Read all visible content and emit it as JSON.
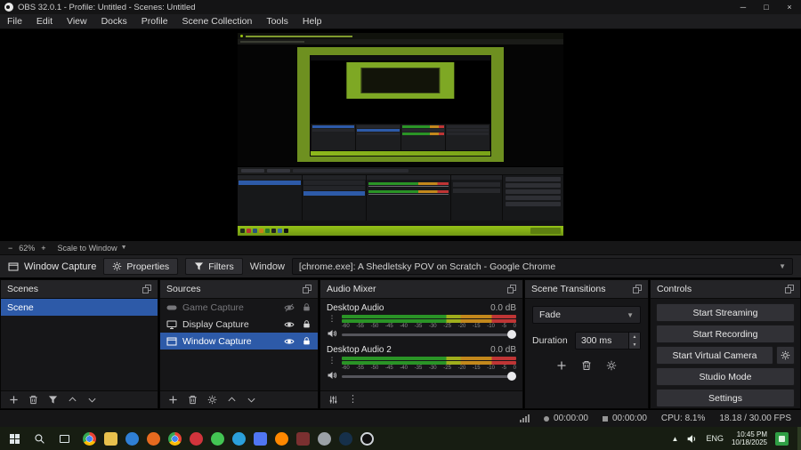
{
  "colors": {
    "accent": "#2d5aa8",
    "meter_green": "#2a9426",
    "meter_orange": "#c3881c",
    "meter_red": "#bf3535",
    "taskbar_green": "#8fbf17"
  },
  "titlebar": {
    "title": "OBS 32.0.1 - Profile: Untitled - Scenes: Untitled",
    "window_buttons": {
      "minimize": "─",
      "maximize": "□",
      "close": "×"
    }
  },
  "menubar": {
    "items": [
      "File",
      "Edit",
      "View",
      "Docks",
      "Profile",
      "Scene Collection",
      "Tools",
      "Help"
    ]
  },
  "preview_toolbar": {
    "zoom_out": "−",
    "zoom_level": "62%",
    "zoom_in": "+",
    "scale_mode": "Scale to Window"
  },
  "source_toolbar": {
    "source_label": "Window Capture",
    "properties": "Properties",
    "filters": "Filters",
    "window_label": "Window",
    "window_value": "[chrome.exe]: A Shedletsky POV on Scratch - Google Chrome"
  },
  "scenes": {
    "title": "Scenes",
    "items": [
      {
        "label": "Scene",
        "selected": true
      }
    ]
  },
  "sources": {
    "title": "Sources",
    "items": [
      {
        "label": "Game Capture",
        "icon": "gamepad-icon",
        "visible": false,
        "locked": true,
        "selected": false
      },
      {
        "label": "Display Capture",
        "icon": "monitor-icon",
        "visible": true,
        "locked": true,
        "selected": false
      },
      {
        "label": "Window Capture",
        "icon": "window-icon",
        "visible": true,
        "locked": true,
        "selected": true
      }
    ]
  },
  "audio_mixer": {
    "title": "Audio Mixer",
    "channels": [
      {
        "name": "Desktop Audio",
        "level": "0.0 dB"
      },
      {
        "name": "Desktop Audio 2",
        "level": "0.0 dB"
      }
    ],
    "ticks": [
      "-60",
      "-55",
      "-50",
      "-45",
      "-40",
      "-35",
      "-30",
      "-25",
      "-20",
      "-15",
      "-10",
      "-5",
      "0"
    ]
  },
  "scene_transitions": {
    "title": "Scene Transitions",
    "transition": "Fade",
    "duration_label": "Duration",
    "duration_value": "300 ms"
  },
  "controls": {
    "title": "Controls",
    "start_streaming": "Start Streaming",
    "start_recording": "Start Recording",
    "start_virtual_camera": "Start Virtual Camera",
    "studio_mode": "Studio Mode",
    "settings": "Settings"
  },
  "statusbar": {
    "rec_time": "00:00:00",
    "stream_time": "00:00:00",
    "cpu": "CPU: 8.1%",
    "fps": "18.18 / 30.00 FPS"
  },
  "taskbar": {
    "language": "ENG",
    "time": "10:45 PM",
    "date": "10/18/2025",
    "apps": [
      "chrome",
      "folder",
      "edge",
      "firefox",
      "chrome",
      "opera",
      "whatsapp",
      "telegram",
      "discord",
      "vlc",
      "app",
      "app",
      "steam",
      "obs"
    ]
  }
}
